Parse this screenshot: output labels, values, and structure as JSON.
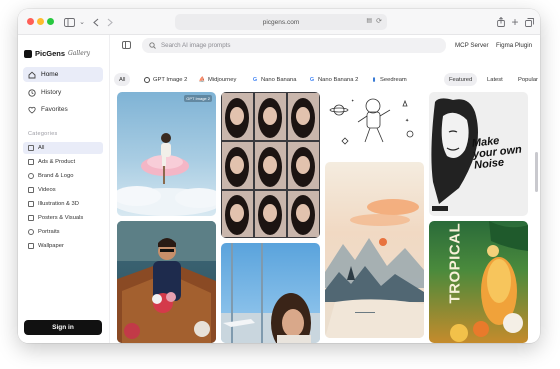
{
  "browser": {
    "url": "picgens.com",
    "title_bar_icons": [
      "sidebar-icon",
      "chevron-left-icon",
      "chevron-right-icon",
      "translate-icon",
      "refresh-icon",
      "share-icon",
      "plus-icon",
      "tabs-icon"
    ]
  },
  "brand": {
    "name": "PicGens",
    "sub": "Gallery"
  },
  "nav": {
    "items": [
      {
        "label": "Home",
        "icon": "home-icon",
        "active": true
      },
      {
        "label": "History",
        "icon": "history-icon",
        "active": false
      },
      {
        "label": "Favorites",
        "icon": "heart-icon",
        "active": false
      }
    ]
  },
  "categories": {
    "heading": "Categories",
    "items": [
      {
        "label": "All",
        "active": true
      },
      {
        "label": "Ads & Product",
        "active": false
      },
      {
        "label": "Brand & Logo",
        "active": false
      },
      {
        "label": "Videos",
        "active": false
      },
      {
        "label": "Illustration & 3D",
        "active": false
      },
      {
        "label": "Posters & Visuals",
        "active": false
      },
      {
        "label": "Portraits",
        "active": false
      },
      {
        "label": "Wallpaper",
        "active": false
      }
    ]
  },
  "signin": {
    "label": "Sign in"
  },
  "search": {
    "placeholder": "Search AI image prompts"
  },
  "top_links": {
    "mcp": "MCP Server",
    "figma": "Figma Plugin"
  },
  "filters": {
    "models": [
      {
        "label": "All",
        "icon": ""
      },
      {
        "label": "GPT Image 2",
        "icon": "openai-icon"
      },
      {
        "label": "Midjourney",
        "icon": "sail-icon"
      },
      {
        "label": "Nano Banana",
        "icon": "google-icon"
      },
      {
        "label": "Nano Banana 2",
        "icon": "google-icon"
      },
      {
        "label": "Seedream",
        "icon": "seedream-icon"
      }
    ],
    "sort": [
      {
        "label": "Featured",
        "active": true
      },
      {
        "label": "Latest",
        "active": false
      },
      {
        "label": "Popular",
        "active": false
      }
    ]
  },
  "gallery": {
    "cards": [
      {
        "name": "card-cloud-portrait",
        "tag": "GPT Image 2"
      },
      {
        "name": "card-selfie-grid"
      },
      {
        "name": "card-astronaut-sketch"
      },
      {
        "name": "card-make-your-own-noise",
        "poster_text": "Make your own Noise"
      },
      {
        "name": "card-boat-flowers"
      },
      {
        "name": "card-ink-landscape"
      },
      {
        "name": "card-tropical-drink",
        "poster_text": "TROPICAL"
      },
      {
        "name": "card-airport-selfie"
      }
    ]
  },
  "colors": {
    "accent": "#e9ecf8",
    "signin_bg": "#111111"
  }
}
